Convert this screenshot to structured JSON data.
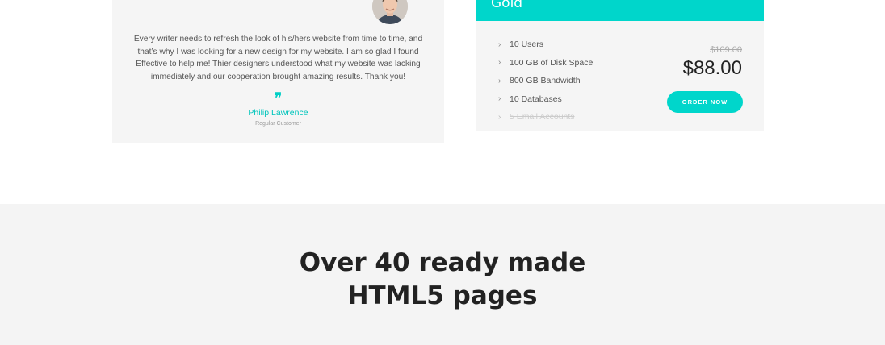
{
  "testimonial": {
    "text": "Every writer needs to refresh the look of his/hers website from time to time, and that’s why I was looking for a new design for my website. I am so glad I found Effective to help me! Thier designers understood what my website was lacking immediately and our cooperation brought amazing results. Thank you!",
    "quote_glyph": "❞",
    "author": "Philip Lawrence",
    "role": "Regular Customer"
  },
  "pricing": {
    "plan": "Gold",
    "features": [
      {
        "label": "10 Users",
        "available": true
      },
      {
        "label": "100 GB of Disk Space",
        "available": true
      },
      {
        "label": "800 GB Bandwidth",
        "available": true
      },
      {
        "label": "10 Databases",
        "available": true
      },
      {
        "label": "5 Email Accounts",
        "available": false
      }
    ],
    "old_price": "$109.00",
    "price": "$88.00",
    "order_label": "ORDER NOW",
    "accent_color": "#00d6cb"
  },
  "section": {
    "title_line1": "Over 40 ready made",
    "title_line2": "HTML5 pages"
  },
  "icons": [
    "avatar-photo",
    "chevron-right-icon",
    "quote-icon"
  ]
}
